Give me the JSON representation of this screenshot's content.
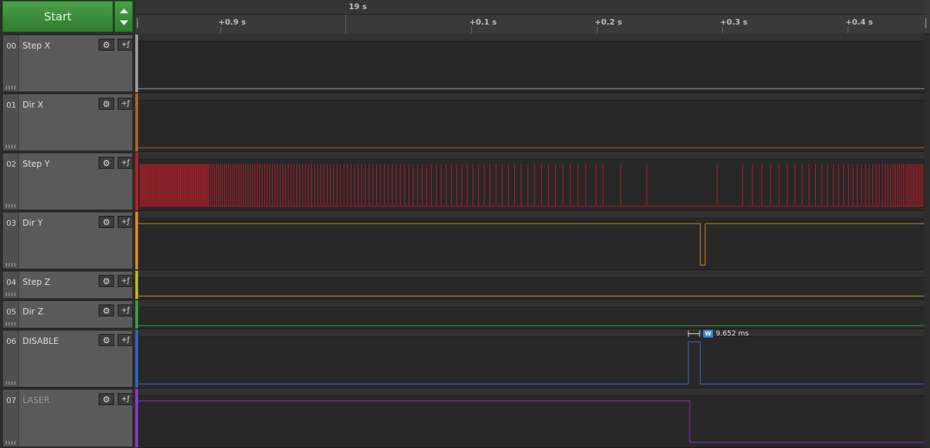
{
  "controls": {
    "start_label": "Start"
  },
  "timeline": {
    "absolute": "19 s",
    "ticks": [
      "+0.9 s",
      "+0.1 s",
      "+0.2 s",
      "+0.3 s",
      "+0.4 s"
    ]
  },
  "channels": [
    {
      "num": "00",
      "name": "Step X",
      "color": "#9a9a9a"
    },
    {
      "num": "01",
      "name": "Dir X",
      "color": "#b0622a"
    },
    {
      "num": "02",
      "name": "Step Y",
      "color": "#c01a28"
    },
    {
      "num": "03",
      "name": "Dir Y",
      "color": "#d98a1c"
    },
    {
      "num": "04",
      "name": "Step Z",
      "color": "#c6b21a"
    },
    {
      "num": "05",
      "name": "Dir Z",
      "color": "#3aa03a"
    },
    {
      "num": "06",
      "name": "DISABLE",
      "color": "#2f63c8"
    },
    {
      "num": "07",
      "name": "LASER",
      "color": "#8a38c8"
    }
  ],
  "icons": {
    "settings": "gear-icon",
    "add_analyzer": "add-analyzer-icon",
    "grip": "grip-icon"
  },
  "measurement": {
    "label": "9.652 ms",
    "icon_text": "W"
  }
}
